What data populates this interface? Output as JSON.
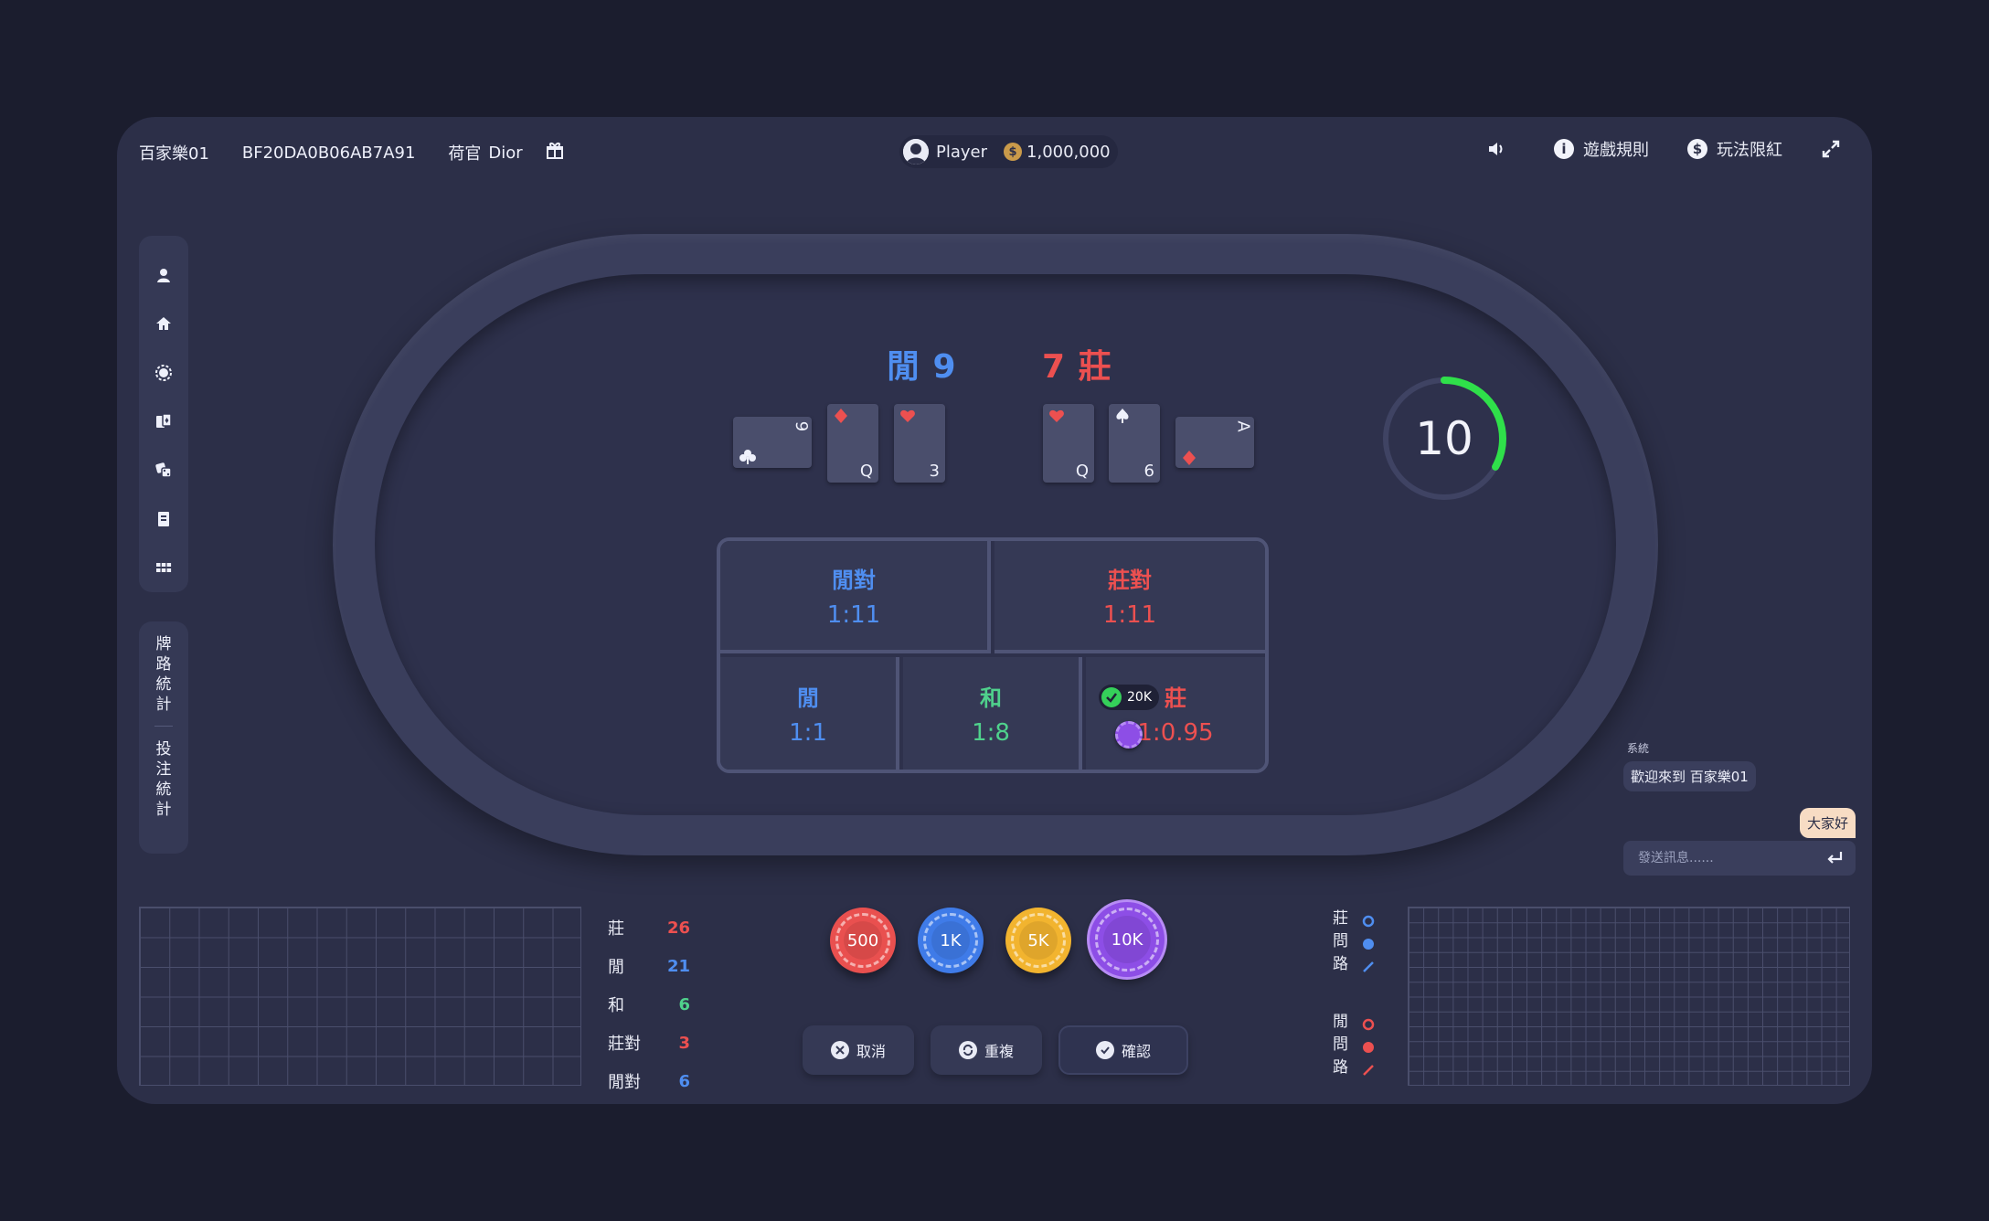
{
  "header": {
    "room_name": "百家樂01",
    "game_id": "BF20DA0B06AB7A91",
    "dealer_label": "荷官",
    "dealer_name": "Dior",
    "player_name": "Player",
    "balance": "1,000,000",
    "coin_symbol": "$",
    "info_symbol": "i",
    "rules_label": "遊戲規則",
    "limits_label": "玩法限紅"
  },
  "sidebar": {
    "icons": [
      "user-icon",
      "home-icon",
      "chip-icon",
      "cards-icon",
      "dice-icon",
      "document-icon",
      "grid-icon"
    ],
    "stats_road_label": "牌路統計",
    "stats_bet_label": "投注統計"
  },
  "scores": {
    "player": "閒 9",
    "banker": "7 莊"
  },
  "player_cards": [
    {
      "rank": "9",
      "suit": "clubs",
      "orientation": "horizontal"
    },
    {
      "rank": "Q",
      "suit": "diamonds",
      "orientation": "vertical"
    },
    {
      "rank": "3",
      "suit": "hearts",
      "orientation": "vertical"
    }
  ],
  "banker_cards": [
    {
      "rank": "Q",
      "suit": "hearts",
      "orientation": "vertical"
    },
    {
      "rank": "6",
      "suit": "spades",
      "orientation": "vertical"
    },
    {
      "rank": "A",
      "suit": "diamonds",
      "orientation": "horizontal"
    }
  ],
  "timer": {
    "seconds": "10",
    "progress": 0.33,
    "color": "#2fe04a"
  },
  "bets": {
    "player_pair": {
      "label": "閒對",
      "odds": "1:11"
    },
    "banker_pair": {
      "label": "莊對",
      "odds": "1:11"
    },
    "player": {
      "label": "閒",
      "odds": "1:1"
    },
    "tie": {
      "label": "和",
      "odds": "1:8"
    },
    "banker": {
      "label": "莊",
      "odds": "1:0.95",
      "placed_amount": "20K"
    }
  },
  "chat": {
    "system_name": "系統",
    "system_message": "歡迎來到 百家樂01",
    "my_message": "大家好",
    "input_placeholder": "發送訊息......"
  },
  "stats": [
    {
      "label": "莊",
      "value": "26",
      "color": "#ec5050"
    },
    {
      "label": "閒",
      "value": "21",
      "color": "#4f8ef0"
    },
    {
      "label": "和",
      "value": "6",
      "color": "#4fd18c"
    },
    {
      "label": "莊對",
      "value": "3",
      "color": "#ec5050"
    },
    {
      "label": "閒對",
      "value": "6",
      "color": "#4f8ef0"
    }
  ],
  "chips": [
    {
      "label": "500",
      "color": "#e9504f"
    },
    {
      "label": "1K",
      "color": "#3f7be8"
    },
    {
      "label": "5K",
      "color": "#f2b42f"
    },
    {
      "label": "10K",
      "color": "#8d4ee6"
    }
  ],
  "actions": {
    "cancel": "取消",
    "repeat": "重複",
    "confirm": "確認"
  },
  "road_legends": {
    "banker_ask": "莊問路",
    "player_ask": "閒問路"
  },
  "colors": {
    "banker": "#ec5050",
    "player": "#4f8ef0",
    "tie": "#4fd18c",
    "background": "#2c2f48"
  }
}
